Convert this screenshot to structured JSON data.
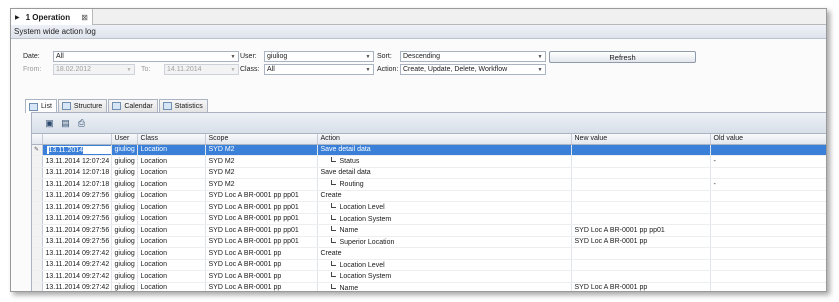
{
  "tab": {
    "title": "1 Operation",
    "close": "⊠"
  },
  "panel": {
    "title": "System wide action log"
  },
  "filters": {
    "date_label": "Date:",
    "date_value": "All",
    "from_label": "From:",
    "from_value": "18.02.2012",
    "to_label": "To:",
    "to_value": "14.11.2014",
    "user_label": "User:",
    "user_value": "giuliog",
    "class_label": "Class:",
    "class_value": "All",
    "sort_label": "Sort:",
    "sort_value": "Descending",
    "action_label": "Action:",
    "action_value": "Create, Update, Delete, Workflow",
    "refresh_label": "Refresh"
  },
  "view_tabs": [
    {
      "label": "List",
      "icon": "list-icon"
    },
    {
      "label": "Structure",
      "icon": "structure-icon"
    },
    {
      "label": "Calendar",
      "icon": "calendar-icon"
    },
    {
      "label": "Statistics",
      "icon": "statistics-icon"
    }
  ],
  "toolbar": {
    "icons": [
      "export-icon",
      "save-icon",
      "print-icon"
    ]
  },
  "columns": [
    "",
    "User",
    "Class",
    "Scope",
    "Action",
    "New value",
    "Old value"
  ],
  "rows": [
    {
      "date": "13.11.2014",
      "user": "giuliog",
      "class": "Location",
      "scope": "SYD M2",
      "action": "Save detail data",
      "sub": false,
      "new": "",
      "old": ""
    },
    {
      "date": "13.11.2014 12:07:24",
      "user": "giuliog",
      "class": "Location",
      "scope": "SYD M2",
      "action": "Status",
      "sub": true,
      "new": "",
      "old": "-"
    },
    {
      "date": "13.11.2014 12:07:18",
      "user": "giuliog",
      "class": "Location",
      "scope": "SYD M2",
      "action": "Save detail data",
      "sub": false,
      "new": "",
      "old": ""
    },
    {
      "date": "13.11.2014 12:07:18",
      "user": "giuliog",
      "class": "Location",
      "scope": "SYD M2",
      "action": "Routing",
      "sub": true,
      "new": "",
      "old": "-"
    },
    {
      "date": "13.11.2014 09:27:56",
      "user": "giuliog",
      "class": "Location",
      "scope": "SYD Loc A BR-0001 pp pp01",
      "action": "Create",
      "sub": false,
      "new": "",
      "old": ""
    },
    {
      "date": "13.11.2014 09:27:56",
      "user": "giuliog",
      "class": "Location",
      "scope": "SYD Loc A BR-0001 pp pp01",
      "action": "Location Level",
      "sub": true,
      "new": "",
      "old": ""
    },
    {
      "date": "13.11.2014 09:27:56",
      "user": "giuliog",
      "class": "Location",
      "scope": "SYD Loc A BR-0001 pp pp01",
      "action": "Location System",
      "sub": true,
      "new": "",
      "old": ""
    },
    {
      "date": "13.11.2014 09:27:56",
      "user": "giuliog",
      "class": "Location",
      "scope": "SYD Loc A BR-0001 pp pp01",
      "action": "Name",
      "sub": true,
      "new": "SYD Loc A BR-0001 pp pp01",
      "old": ""
    },
    {
      "date": "13.11.2014 09:27:56",
      "user": "giuliog",
      "class": "Location",
      "scope": "SYD Loc A BR-0001 pp pp01",
      "action": "Superior Location",
      "sub": true,
      "new": "SYD Loc A BR-0001 pp",
      "old": ""
    },
    {
      "date": "13.11.2014 09:27:42",
      "user": "giuliog",
      "class": "Location",
      "scope": "SYD Loc A BR-0001 pp",
      "action": "Create",
      "sub": false,
      "new": "",
      "old": ""
    },
    {
      "date": "13.11.2014 09:27:42",
      "user": "giuliog",
      "class": "Location",
      "scope": "SYD Loc A BR-0001 pp",
      "action": "Location Level",
      "sub": true,
      "new": "",
      "old": ""
    },
    {
      "date": "13.11.2014 09:27:42",
      "user": "giuliog",
      "class": "Location",
      "scope": "SYD Loc A BR-0001 pp",
      "action": "Location System",
      "sub": true,
      "new": "",
      "old": ""
    },
    {
      "date": "13.11.2014 09:27:42",
      "user": "giuliog",
      "class": "Location",
      "scope": "SYD Loc A BR-0001 pp",
      "action": "Name",
      "sub": true,
      "new": "SYD Loc A BR-0001 pp",
      "old": ""
    }
  ],
  "colors": {
    "selection": "#3a7fd8",
    "header_bg": "#dfe4ec",
    "border": "#a9b3c2"
  }
}
